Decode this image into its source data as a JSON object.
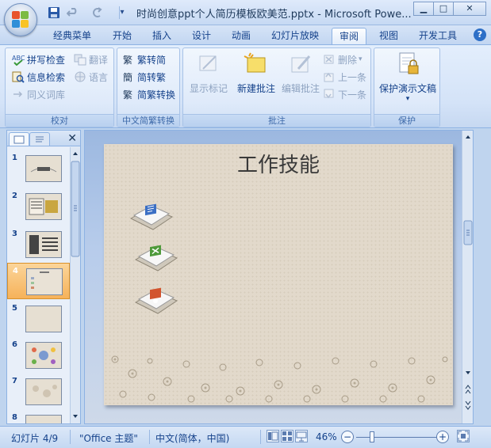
{
  "titlebar": {
    "title": "时尚创意ppt个人简历模板欧美范.pptx - Microsoft Powe...",
    "qa_icons": [
      "save-icon",
      "undo-icon",
      "redo-icon",
      "customize-icon"
    ],
    "minimize": "▁",
    "maximize": "□",
    "close": "✕"
  },
  "tabs": [
    {
      "label": "经典菜单"
    },
    {
      "label": "开始"
    },
    {
      "label": "插入"
    },
    {
      "label": "设计"
    },
    {
      "label": "动画"
    },
    {
      "label": "幻灯片放映"
    },
    {
      "label": "审阅",
      "active": true
    },
    {
      "label": "视图"
    },
    {
      "label": "开发工具"
    }
  ],
  "help": "?",
  "ribbon": {
    "proofing": {
      "label": "校对",
      "spell": "拼写检查",
      "research": "信息检索",
      "thesaurus": "同义词库",
      "translate": "翻译",
      "language": "语言"
    },
    "chinese": {
      "label": "中文简繁转换",
      "to_simplified": "繁转简",
      "to_traditional": "简转繁",
      "convert": "简繁转换"
    },
    "comments": {
      "label": "批注",
      "show_markup": "显示标记",
      "new_comment": "新建批注",
      "edit_comment": "编辑批注",
      "delete": "删除",
      "previous": "上一条",
      "next": "下一条"
    },
    "protect": {
      "label": "保护",
      "protect_presentation": "保护演示文稿"
    }
  },
  "slides_pane": {
    "close": "✕",
    "thumbs": [
      "1",
      "2",
      "3",
      "4",
      "5",
      "6",
      "7",
      "8"
    ],
    "selected": 4
  },
  "slide": {
    "title": "工作技能"
  },
  "statusbar": {
    "slide_info": "幻灯片 4/9",
    "theme": "\"Office 主题\"",
    "language": "中文(简体，中国)",
    "zoom": "46%",
    "zoom_out": "−",
    "zoom_in": "+"
  },
  "colors": {
    "ribbon_text": "#15428b",
    "selected_thumb": "#f6b25a",
    "slide_bg": "#e2d9cb",
    "title_color": "#3a3a3a"
  }
}
